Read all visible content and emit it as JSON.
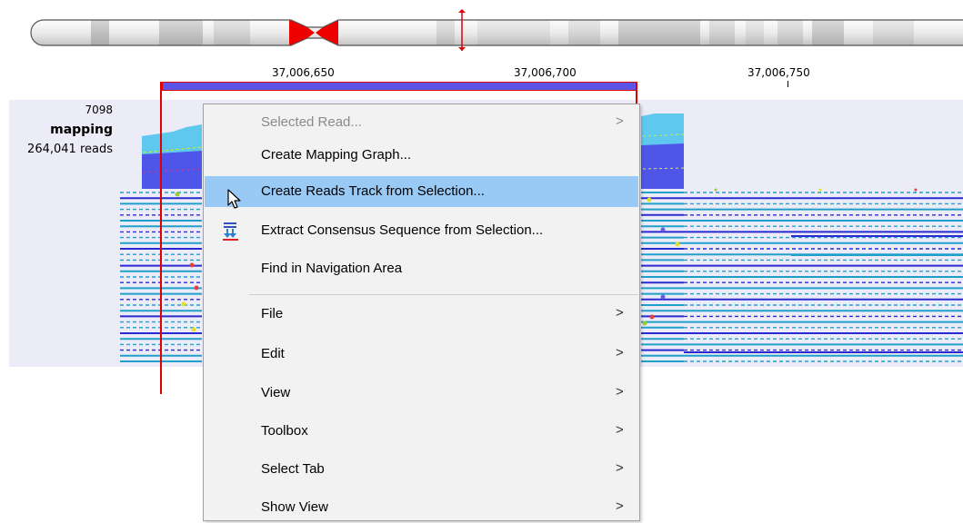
{
  "ideogram": {
    "outline_color": "#555555",
    "centromere_color": "#ee0000",
    "position_marker_color": "#e00000"
  },
  "ruler": {
    "labels": [
      "37,006,650",
      "37,006,700",
      "37,006,750"
    ]
  },
  "track": {
    "max_coverage": "7098",
    "name": "mapping",
    "read_count": "264,041 reads",
    "colors": {
      "coverage_light": "#5ec8ee",
      "coverage_dark": "#4f55e8",
      "read_forward": "#1fa0c8",
      "read_reverse": "#2a2ad0",
      "selection": "#e00000"
    }
  },
  "context_menu": {
    "items": [
      {
        "label": "Selected Read...",
        "has_submenu": true,
        "disabled": true
      },
      {
        "label": "Create Mapping Graph...",
        "has_submenu": false
      },
      {
        "label": "Create Reads Track from Selection...",
        "has_submenu": false,
        "highlighted": true
      },
      {
        "label": "Extract Consensus Sequence from Selection...",
        "has_submenu": false,
        "icon": "extract-consensus-icon"
      },
      {
        "label": "Find in Navigation Area",
        "has_submenu": false
      },
      {
        "label": "File",
        "has_submenu": true
      },
      {
        "label": "Edit",
        "has_submenu": true
      },
      {
        "label": "View",
        "has_submenu": true
      },
      {
        "label": "Toolbox",
        "has_submenu": true
      },
      {
        "label": "Select Tab",
        "has_submenu": true
      },
      {
        "label": "Show View",
        "has_submenu": true
      }
    ],
    "submenu_arrow": ">"
  },
  "cursor": {
    "icon": "mouse-pointer-icon"
  }
}
